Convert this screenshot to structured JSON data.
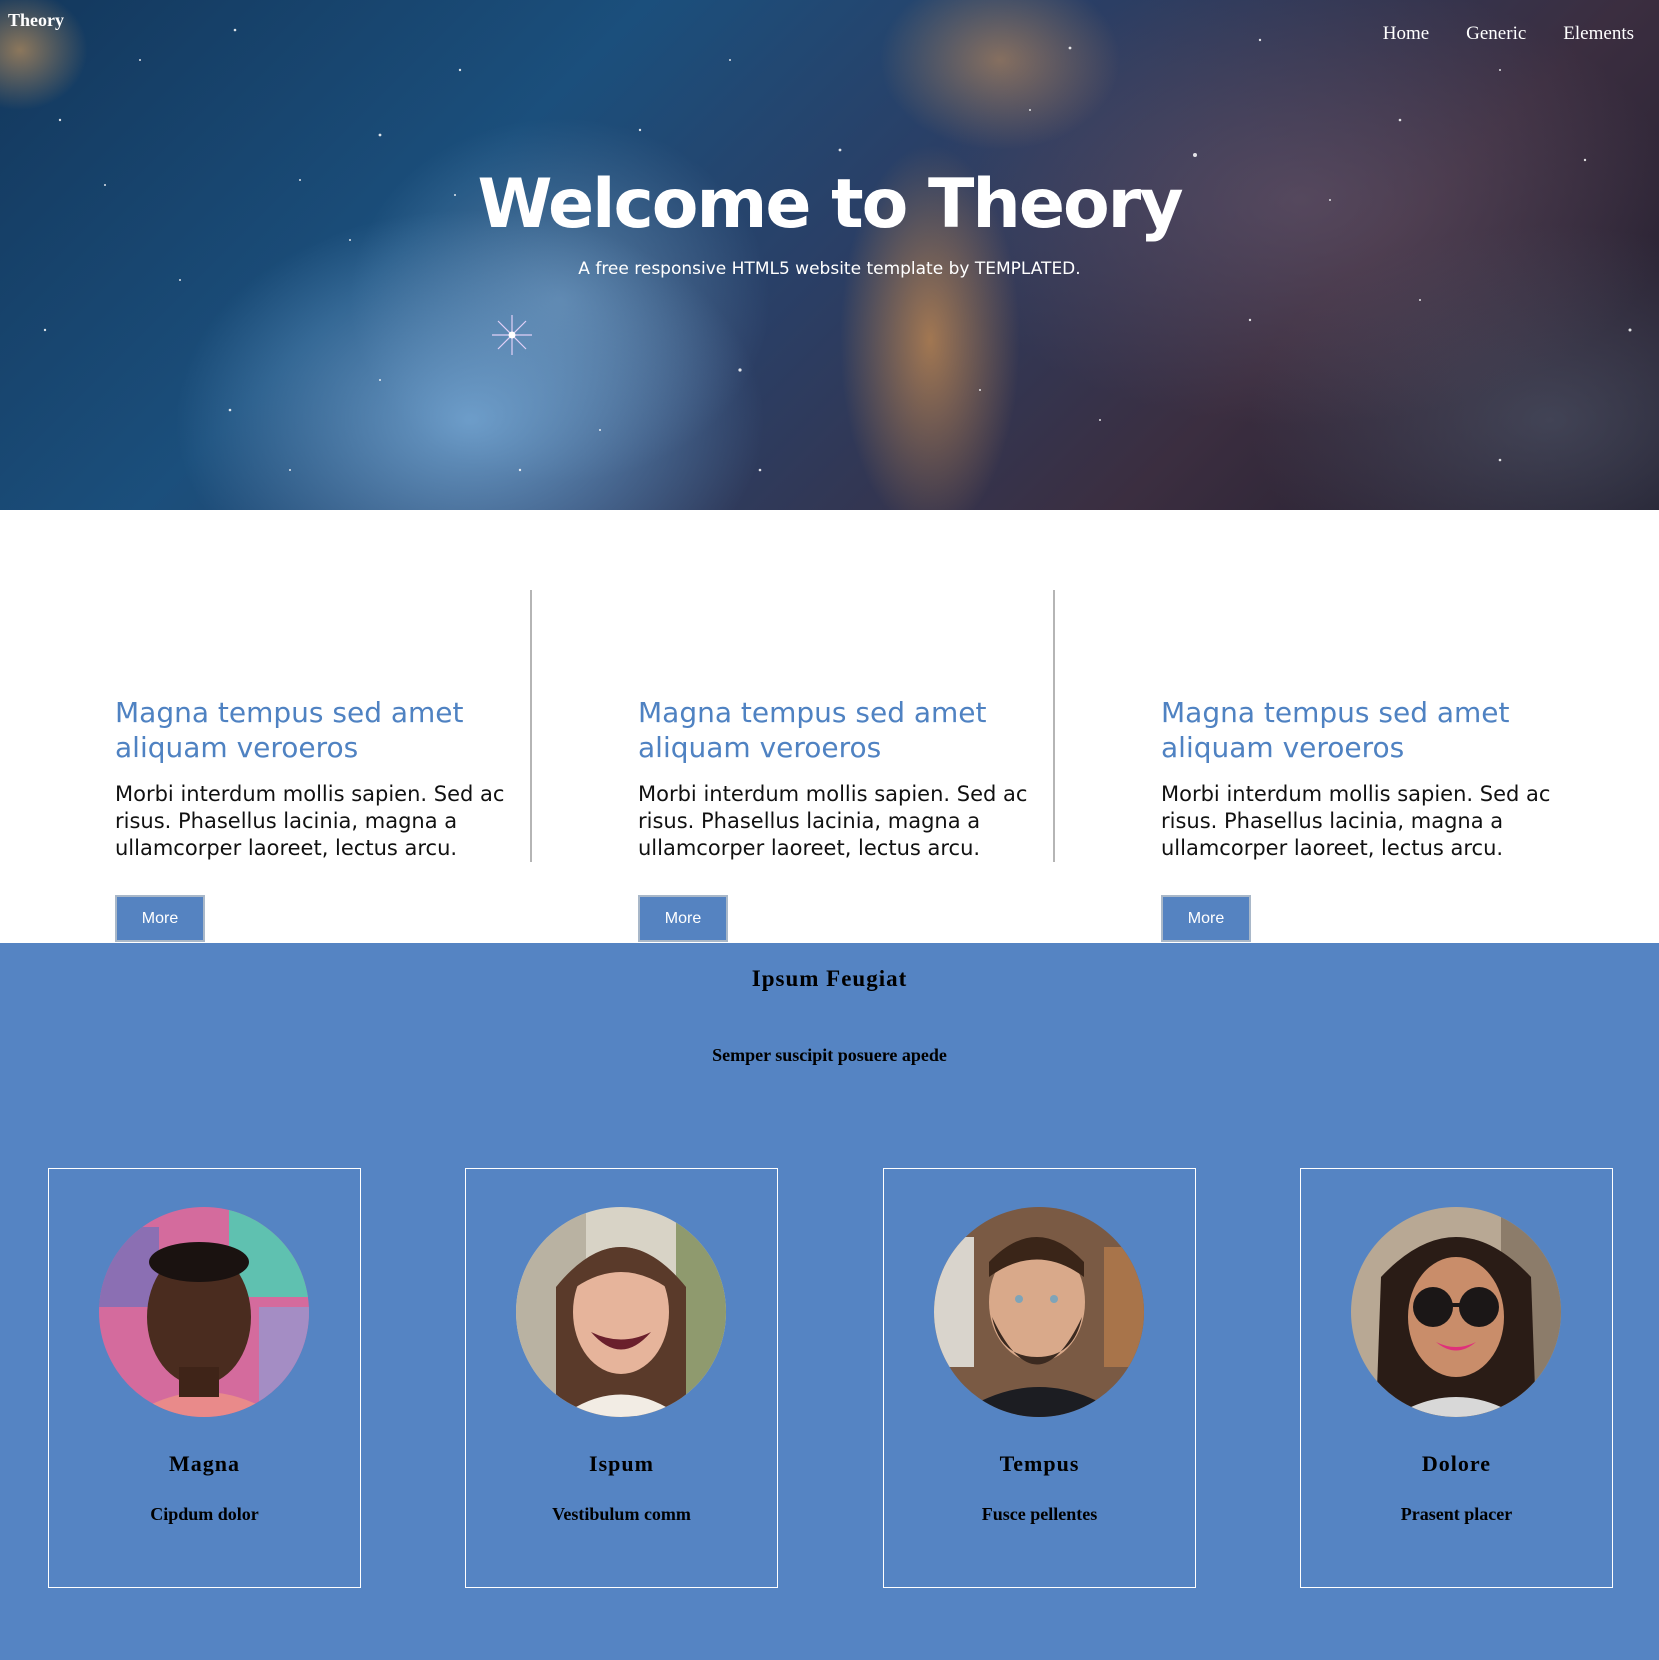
{
  "header": {
    "brand": "Theory",
    "nav": [
      {
        "label": "Home"
      },
      {
        "label": "Generic"
      },
      {
        "label": "Elements"
      }
    ]
  },
  "hero": {
    "title": "Welcome to Theory",
    "subtitle": "A free responsive HTML5 website template by TEMPLATED."
  },
  "features": [
    {
      "title": "Magna tempus sed amet aliquam veroeros",
      "body": "Morbi interdum mollis sapien. Sed ac risus. Phasellus lacinia, magna a ullamcorper laoreet, lectus arcu.",
      "button": "More"
    },
    {
      "title": "Magna tempus sed amet aliquam veroeros",
      "body": "Morbi interdum mollis sapien. Sed ac risus. Phasellus lacinia, magna a ullamcorper laoreet, lectus arcu.",
      "button": "More"
    },
    {
      "title": "Magna tempus sed amet aliquam veroeros",
      "body": "Morbi interdum mollis sapien. Sed ac risus. Phasellus lacinia, magna a ullamcorper laoreet, lectus arcu.",
      "button": "More"
    }
  ],
  "team": {
    "title": "Ipsum Feugiat",
    "subtitle": "Semper suscipit posuere apede",
    "members": [
      {
        "name": "Magna",
        "role": "Cipdum dolor"
      },
      {
        "name": "Ispum",
        "role": "Vestibulum comm"
      },
      {
        "name": "Tempus",
        "role": "Fusce pellentes"
      },
      {
        "name": "Dolore",
        "role": "Prasent placer"
      }
    ]
  },
  "colors": {
    "accent": "#5584c3",
    "feature_title": "#4f82c2",
    "button": "#5583c1"
  }
}
